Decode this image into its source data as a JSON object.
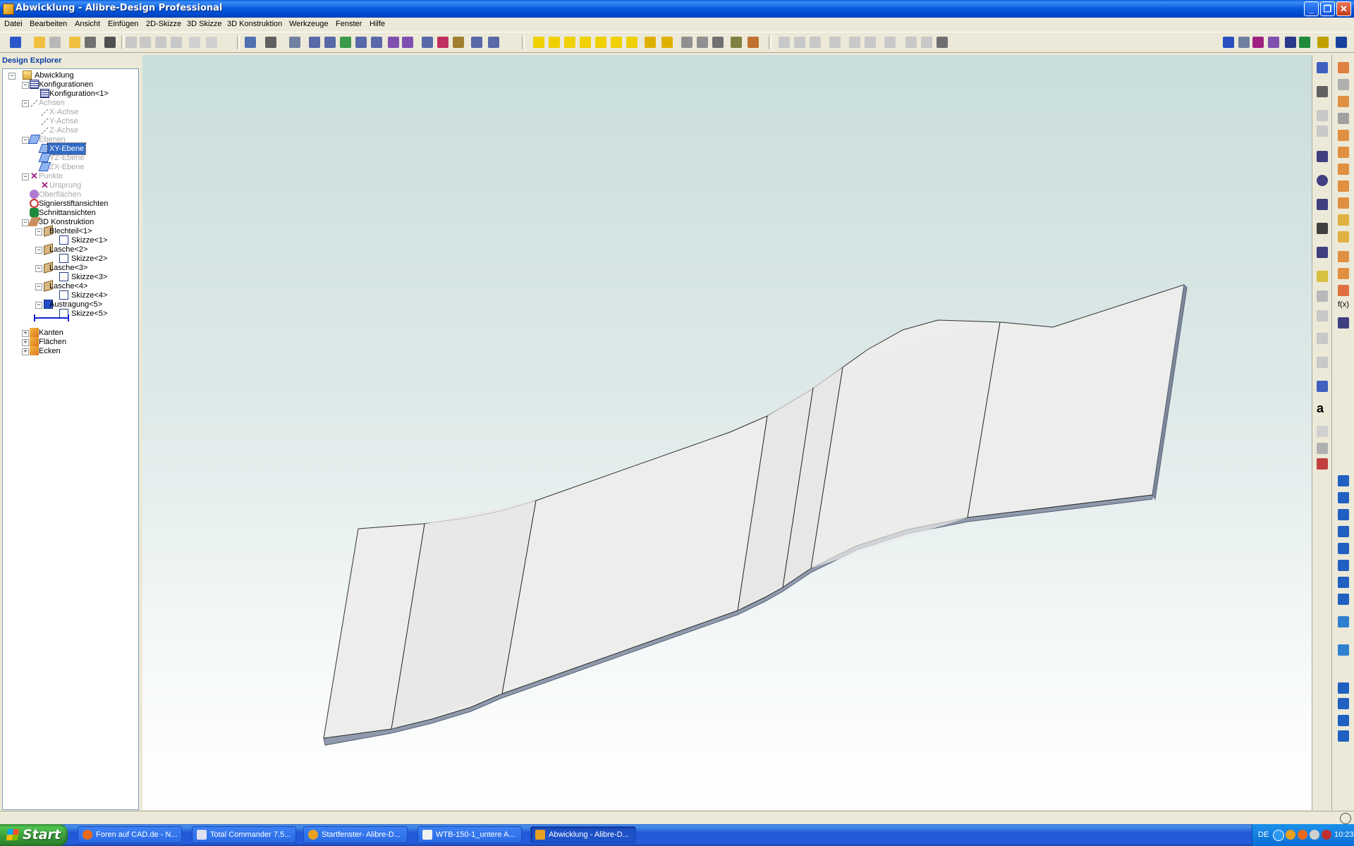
{
  "window": {
    "title": "Abwicklung - Alibre-Design Professional"
  },
  "menu": [
    "Datei",
    "Bearbeiten",
    "Ansicht",
    "Einfügen",
    "2D-Skizze",
    "3D Skizze",
    "3D Konstruktion",
    "Werkzeuge",
    "Fenster",
    "Hilfe"
  ],
  "explorer": {
    "header": "Design Explorer",
    "nodes": [
      {
        "label": "Abwicklung"
      },
      {
        "label": "Konfigurationen"
      },
      {
        "label": "Konfiguration<1>"
      },
      {
        "label": "Achsen"
      },
      {
        "label": "X-Achse"
      },
      {
        "label": "Y-Achse"
      },
      {
        "label": "Z-Achse"
      },
      {
        "label": "Ebenen"
      },
      {
        "label": "XY-Ebene"
      },
      {
        "label": "YZ-Ebene"
      },
      {
        "label": "ZX-Ebene"
      },
      {
        "label": "Punkte"
      },
      {
        "label": "Ursprung"
      },
      {
        "label": "Oberflächen"
      },
      {
        "label": "Signierstiftansichten"
      },
      {
        "label": "Schnittansichten"
      },
      {
        "label": "3D Konstruktion"
      },
      {
        "label": "Blechteil<1>"
      },
      {
        "label": "Skizze<1>"
      },
      {
        "label": "Lasche<2>"
      },
      {
        "label": "Skizze<2>"
      },
      {
        "label": "Lasche<3>"
      },
      {
        "label": "Skizze<3>"
      },
      {
        "label": "Lasche<4>"
      },
      {
        "label": "Skizze<4>"
      },
      {
        "label": "Austragung<5>"
      },
      {
        "label": "Skizze<5>"
      },
      {
        "label": "Kanten"
      },
      {
        "label": "Flächen"
      },
      {
        "label": "Ecken"
      }
    ]
  },
  "taskbar": {
    "start": "Start",
    "tasks": [
      {
        "label": "Foren auf CAD.de - N...",
        "icon": "firefox-icon"
      },
      {
        "label": "Total Commander 7.5...",
        "icon": "total-commander-icon"
      },
      {
        "label": "Startfenster- Alibre-D...",
        "icon": "alibre-icon"
      },
      {
        "label": "WTB-150-1_untere A...",
        "icon": "document-icon"
      },
      {
        "label": "Abwicklung - Alibre-D...",
        "icon": "alibre-icon"
      }
    ],
    "tray": {
      "language": "DE",
      "clock": "10:23"
    }
  },
  "colors": {
    "titlebar": "#0a5ee0",
    "selection": "#316ac5",
    "part_edge": "#8a96a8"
  }
}
